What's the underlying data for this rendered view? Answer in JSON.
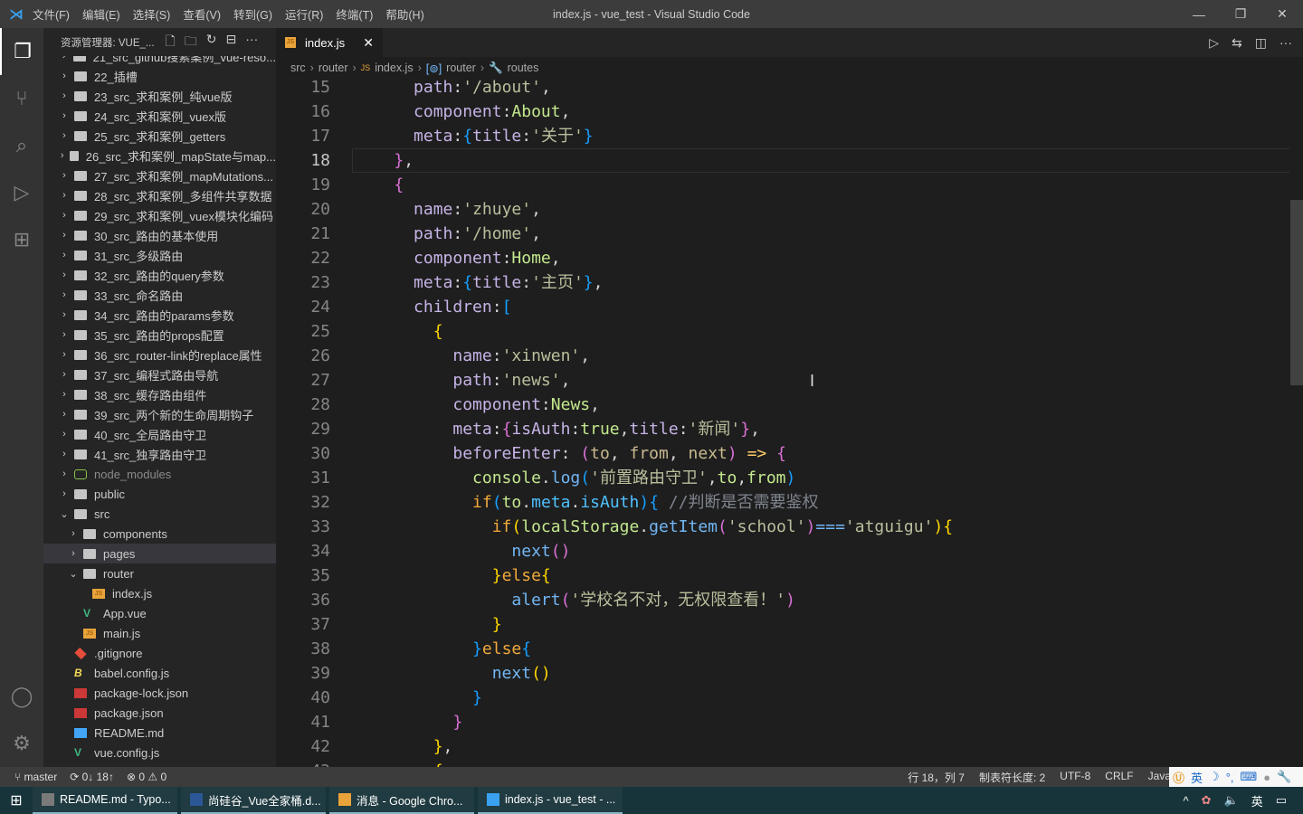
{
  "titlebar": {
    "menu": [
      "文件(F)",
      "编辑(E)",
      "选择(S)",
      "查看(V)",
      "转到(G)",
      "运行(R)",
      "终端(T)",
      "帮助(H)"
    ],
    "title": "index.js - vue_test - Visual Studio Code"
  },
  "sidebar": {
    "title": "资源管理器: VUE_...",
    "items": [
      {
        "label": "21_src_github搜索案例_vue-reso...",
        "type": "folder",
        "depth": 0,
        "open": false
      },
      {
        "label": "22_插槽",
        "type": "folder",
        "depth": 0,
        "open": false
      },
      {
        "label": "23_src_求和案例_纯vue版",
        "type": "folder",
        "depth": 0,
        "open": false
      },
      {
        "label": "24_src_求和案例_vuex版",
        "type": "folder",
        "depth": 0,
        "open": false
      },
      {
        "label": "25_src_求和案例_getters",
        "type": "folder",
        "depth": 0,
        "open": false
      },
      {
        "label": "26_src_求和案例_mapState与map...",
        "type": "folder",
        "depth": 0,
        "open": false
      },
      {
        "label": "27_src_求和案例_mapMutations...",
        "type": "folder",
        "depth": 0,
        "open": false
      },
      {
        "label": "28_src_求和案例_多组件共享数据",
        "type": "folder",
        "depth": 0,
        "open": false
      },
      {
        "label": "29_src_求和案例_vuex模块化编码",
        "type": "folder",
        "depth": 0,
        "open": false
      },
      {
        "label": "30_src_路由的基本使用",
        "type": "folder",
        "depth": 0,
        "open": false
      },
      {
        "label": "31_src_多级路由",
        "type": "folder",
        "depth": 0,
        "open": false
      },
      {
        "label": "32_src_路由的query参数",
        "type": "folder",
        "depth": 0,
        "open": false
      },
      {
        "label": "33_src_命名路由",
        "type": "folder",
        "depth": 0,
        "open": false
      },
      {
        "label": "34_src_路由的params参数",
        "type": "folder",
        "depth": 0,
        "open": false
      },
      {
        "label": "35_src_路由的props配置",
        "type": "folder",
        "depth": 0,
        "open": false
      },
      {
        "label": "36_src_router-link的replace属性",
        "type": "folder",
        "depth": 0,
        "open": false
      },
      {
        "label": "37_src_编程式路由导航",
        "type": "folder",
        "depth": 0,
        "open": false
      },
      {
        "label": "38_src_缓存路由组件",
        "type": "folder",
        "depth": 0,
        "open": false
      },
      {
        "label": "39_src_两个新的生命周期钩子",
        "type": "folder",
        "depth": 0,
        "open": false
      },
      {
        "label": "40_src_全局路由守卫",
        "type": "folder",
        "depth": 0,
        "open": false
      },
      {
        "label": "41_src_独享路由守卫",
        "type": "folder",
        "depth": 0,
        "open": false
      },
      {
        "label": "node_modules",
        "type": "node",
        "depth": 0,
        "open": false,
        "dim": true
      },
      {
        "label": "public",
        "type": "folder",
        "depth": 0,
        "open": false
      },
      {
        "label": "src",
        "type": "folder",
        "depth": 0,
        "open": true
      },
      {
        "label": "components",
        "type": "folder",
        "depth": 1,
        "open": false
      },
      {
        "label": "pages",
        "type": "folder",
        "depth": 1,
        "open": false,
        "selected": true
      },
      {
        "label": "router",
        "type": "folder",
        "depth": 1,
        "open": true
      },
      {
        "label": "index.js",
        "type": "js",
        "depth": 2
      },
      {
        "label": "App.vue",
        "type": "vue",
        "depth": 1
      },
      {
        "label": "main.js",
        "type": "js",
        "depth": 1
      },
      {
        "label": ".gitignore",
        "type": "git",
        "depth": 0
      },
      {
        "label": "babel.config.js",
        "type": "babel",
        "depth": 0
      },
      {
        "label": "package-lock.json",
        "type": "npm",
        "depth": 0
      },
      {
        "label": "package.json",
        "type": "npm",
        "depth": 0
      },
      {
        "label": "README.md",
        "type": "md",
        "depth": 0
      },
      {
        "label": "vue.config.js",
        "type": "vue",
        "depth": 0
      }
    ]
  },
  "editor": {
    "tab": "index.js",
    "breadcrumbs": [
      "src",
      "router",
      "index.js",
      "router",
      "routes"
    ],
    "current_line": 18,
    "lines": [
      {
        "n": 15,
        "t": [
          [
            "w",
            "      "
          ],
          [
            "k",
            "path"
          ],
          [
            "p",
            ":"
          ],
          [
            "s",
            "'/about'"
          ],
          [
            "p",
            ","
          ]
        ]
      },
      {
        "n": 16,
        "t": [
          [
            "w",
            "      "
          ],
          [
            "k",
            "component"
          ],
          [
            "p",
            ":"
          ],
          [
            "i",
            "About"
          ],
          [
            "p",
            ","
          ]
        ]
      },
      {
        "n": 17,
        "t": [
          [
            "w",
            "      "
          ],
          [
            "k",
            "meta"
          ],
          [
            "p",
            ":"
          ],
          [
            "b3",
            "{"
          ],
          [
            "k",
            "title"
          ],
          [
            "p",
            ":"
          ],
          [
            "s",
            "'关于'"
          ],
          [
            "b3",
            "}"
          ]
        ]
      },
      {
        "n": 18,
        "t": [
          [
            "w",
            "    "
          ],
          [
            "b2",
            "}"
          ],
          [
            "p",
            ","
          ]
        ]
      },
      {
        "n": 19,
        "t": [
          [
            "w",
            "    "
          ],
          [
            "b2",
            "{"
          ]
        ]
      },
      {
        "n": 20,
        "t": [
          [
            "w",
            "      "
          ],
          [
            "k",
            "name"
          ],
          [
            "p",
            ":"
          ],
          [
            "s",
            "'zhuye'"
          ],
          [
            "p",
            ","
          ]
        ]
      },
      {
        "n": 21,
        "t": [
          [
            "w",
            "      "
          ],
          [
            "k",
            "path"
          ],
          [
            "p",
            ":"
          ],
          [
            "s",
            "'/home'"
          ],
          [
            "p",
            ","
          ]
        ]
      },
      {
        "n": 22,
        "t": [
          [
            "w",
            "      "
          ],
          [
            "k",
            "component"
          ],
          [
            "p",
            ":"
          ],
          [
            "i",
            "Home"
          ],
          [
            "p",
            ","
          ]
        ]
      },
      {
        "n": 23,
        "t": [
          [
            "w",
            "      "
          ],
          [
            "k",
            "meta"
          ],
          [
            "p",
            ":"
          ],
          [
            "b3",
            "{"
          ],
          [
            "k",
            "title"
          ],
          [
            "p",
            ":"
          ],
          [
            "s",
            "'主页'"
          ],
          [
            "b3",
            "}"
          ],
          [
            "p",
            ","
          ]
        ]
      },
      {
        "n": 24,
        "t": [
          [
            "w",
            "      "
          ],
          [
            "k",
            "children"
          ],
          [
            "p",
            ":"
          ],
          [
            "b3",
            "["
          ]
        ]
      },
      {
        "n": 25,
        "t": [
          [
            "w",
            "        "
          ],
          [
            "b1",
            "{"
          ]
        ]
      },
      {
        "n": 26,
        "t": [
          [
            "w",
            "          "
          ],
          [
            "k",
            "name"
          ],
          [
            "p",
            ":"
          ],
          [
            "s",
            "'xinwen'"
          ],
          [
            "p",
            ","
          ]
        ]
      },
      {
        "n": 27,
        "t": [
          [
            "w",
            "          "
          ],
          [
            "k",
            "path"
          ],
          [
            "p",
            ":"
          ],
          [
            "s",
            "'news'"
          ],
          [
            "p",
            ","
          ]
        ]
      },
      {
        "n": 28,
        "t": [
          [
            "w",
            "          "
          ],
          [
            "k",
            "component"
          ],
          [
            "p",
            ":"
          ],
          [
            "i",
            "News"
          ],
          [
            "p",
            ","
          ]
        ]
      },
      {
        "n": 29,
        "t": [
          [
            "w",
            "          "
          ],
          [
            "k",
            "meta"
          ],
          [
            "p",
            ":"
          ],
          [
            "b2",
            "{"
          ],
          [
            "k",
            "isAuth"
          ],
          [
            "p",
            ":"
          ],
          [
            "i",
            "true"
          ],
          [
            "p",
            ","
          ],
          [
            "k",
            "title"
          ],
          [
            "p",
            ":"
          ],
          [
            "s",
            "'新闻'"
          ],
          [
            "b2",
            "}"
          ],
          [
            "p",
            ","
          ]
        ]
      },
      {
        "n": 30,
        "t": [
          [
            "w",
            "          "
          ],
          [
            "k",
            "beforeEnter"
          ],
          [
            "p",
            ": "
          ],
          [
            "b2",
            "("
          ],
          [
            "pa",
            "to"
          ],
          [
            "p",
            ", "
          ],
          [
            "pa",
            "from"
          ],
          [
            "p",
            ", "
          ],
          [
            "pa",
            "next"
          ],
          [
            "b2",
            ")"
          ],
          [
            "p",
            " "
          ],
          [
            "a",
            "=>"
          ],
          [
            "p",
            " "
          ],
          [
            "b2",
            "{"
          ]
        ]
      },
      {
        "n": 31,
        "t": [
          [
            "w",
            "            "
          ],
          [
            "i",
            "console"
          ],
          [
            "p",
            "."
          ],
          [
            "f",
            "log"
          ],
          [
            "b3",
            "("
          ],
          [
            "s",
            "'前置路由守卫'"
          ],
          [
            "p",
            ","
          ],
          [
            "i",
            "to"
          ],
          [
            "p",
            ","
          ],
          [
            "i",
            "from"
          ],
          [
            "b3",
            ")"
          ]
        ]
      },
      {
        "n": 32,
        "t": [
          [
            "w",
            "            "
          ],
          [
            "kw",
            "if"
          ],
          [
            "b3",
            "("
          ],
          [
            "i",
            "to"
          ],
          [
            "p",
            "."
          ],
          [
            "m",
            "meta"
          ],
          [
            "p",
            "."
          ],
          [
            "m",
            "isAuth"
          ],
          [
            "b3",
            ")"
          ],
          [
            "b3",
            "{"
          ],
          [
            "p",
            " "
          ],
          [
            "c",
            "//判断是否需要鉴权"
          ]
        ]
      },
      {
        "n": 33,
        "t": [
          [
            "w",
            "              "
          ],
          [
            "kw",
            "if"
          ],
          [
            "b1",
            "("
          ],
          [
            "i",
            "localStorage"
          ],
          [
            "p",
            "."
          ],
          [
            "f",
            "getItem"
          ],
          [
            "b2",
            "("
          ],
          [
            "s",
            "'school'"
          ],
          [
            "b2",
            ")"
          ],
          [
            "f",
            "==="
          ],
          [
            "s",
            "'atguigu'"
          ],
          [
            "b1",
            ")"
          ],
          [
            "b1",
            "{"
          ]
        ]
      },
      {
        "n": 34,
        "t": [
          [
            "w",
            "                "
          ],
          [
            "f",
            "next"
          ],
          [
            "b2",
            "()"
          ]
        ]
      },
      {
        "n": 35,
        "t": [
          [
            "w",
            "              "
          ],
          [
            "b1",
            "}"
          ],
          [
            "kw",
            "else"
          ],
          [
            "b1",
            "{"
          ]
        ]
      },
      {
        "n": 36,
        "t": [
          [
            "w",
            "                "
          ],
          [
            "f",
            "alert"
          ],
          [
            "b2",
            "("
          ],
          [
            "s",
            "'学校名不对，无权限查看！'"
          ],
          [
            "b2",
            ")"
          ]
        ]
      },
      {
        "n": 37,
        "t": [
          [
            "w",
            "              "
          ],
          [
            "b1",
            "}"
          ]
        ]
      },
      {
        "n": 38,
        "t": [
          [
            "w",
            "            "
          ],
          [
            "b3",
            "}"
          ],
          [
            "kw",
            "else"
          ],
          [
            "b3",
            "{"
          ]
        ]
      },
      {
        "n": 39,
        "t": [
          [
            "w",
            "              "
          ],
          [
            "f",
            "next"
          ],
          [
            "b1",
            "()"
          ]
        ]
      },
      {
        "n": 40,
        "t": [
          [
            "w",
            "            "
          ],
          [
            "b3",
            "}"
          ]
        ]
      },
      {
        "n": 41,
        "t": [
          [
            "w",
            "          "
          ],
          [
            "b2",
            "}"
          ]
        ]
      },
      {
        "n": 42,
        "t": [
          [
            "w",
            "        "
          ],
          [
            "b1",
            "}"
          ],
          [
            "p",
            ","
          ]
        ]
      },
      {
        "n": 43,
        "t": [
          [
            "w",
            "        "
          ],
          [
            "b1",
            "{"
          ]
        ]
      }
    ]
  },
  "statusbar": {
    "branch": "master",
    "sync": "0↓ 18↑",
    "problems": "⊗ 0 ⚠ 0",
    "position": "行 18，列 7",
    "indent": "制表符长度: 2",
    "encoding": "UTF-8",
    "eol": "CRLF",
    "language": "Java"
  },
  "ime": {
    "mode": "英"
  },
  "taskbar": {
    "items": [
      {
        "label": "README.md - Typo...",
        "color": "#7a7a7a"
      },
      {
        "label": "尚硅谷_Vue全家桶.d...",
        "color": "#2b5797"
      },
      {
        "label": "消息 - Google Chro...",
        "color": "#e8a33a"
      },
      {
        "label": "index.js - vue_test - ...",
        "color": "#3aa0f0"
      }
    ],
    "tray_lang": "英"
  }
}
